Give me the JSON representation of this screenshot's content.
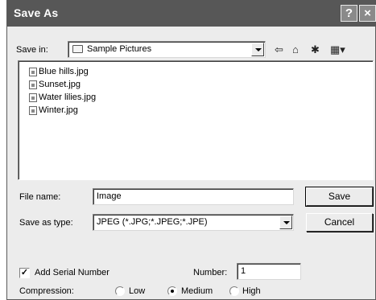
{
  "window": {
    "title": "Save As",
    "help_glyph": "?",
    "close_glyph": "×"
  },
  "save_in": {
    "label": "Save in:",
    "value": "Sample Pictures"
  },
  "toolbar": {
    "back_glyph": "⇦",
    "up_glyph": "⌂",
    "new_folder_glyph": "✱",
    "view_glyph": "▦▾"
  },
  "files": [
    "Blue hills.jpg",
    "Sunset.jpg",
    "Water lilies.jpg",
    "Winter.jpg"
  ],
  "file_name": {
    "label": "File name:",
    "value": "Image"
  },
  "save_as_type": {
    "label": "Save as type:",
    "value": "JPEG (*.JPG;*.JPEG;*.JPE)"
  },
  "buttons": {
    "save": "Save",
    "cancel": "Cancel"
  },
  "serial": {
    "label": "Add Serial Number",
    "checked": true,
    "check_glyph": "✓"
  },
  "number": {
    "label": "Number:",
    "value": "1"
  },
  "compression": {
    "label": "Compression:",
    "options": [
      "Low",
      "Medium",
      "High"
    ],
    "selected": "Medium"
  },
  "colors": {
    "titlebar": "#575757",
    "dialog_bg": "#ececec"
  }
}
